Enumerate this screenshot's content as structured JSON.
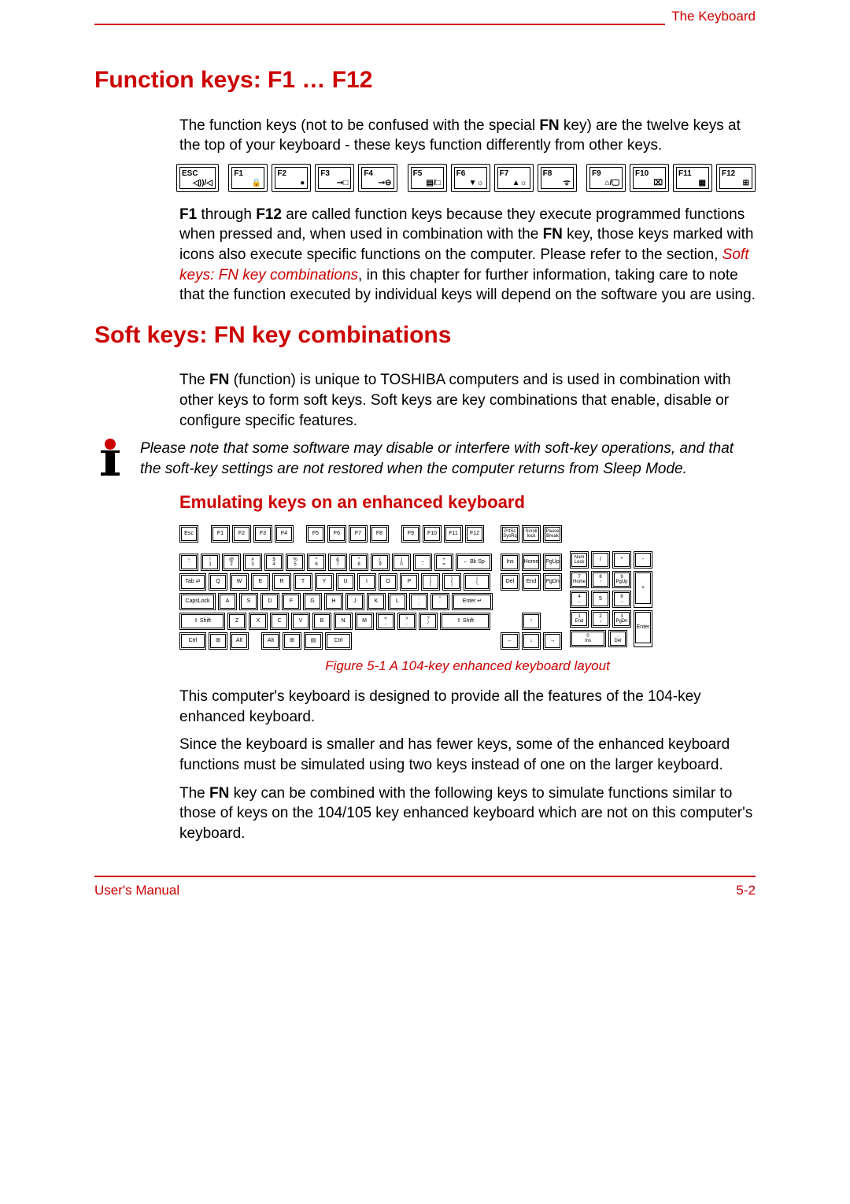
{
  "header": {
    "section": "The Keyboard"
  },
  "h1_a": "Function keys: F1 … F12",
  "p1_a": "The function keys (not to be confused with the special ",
  "p1_bold": "FN",
  "p1_b": " key) are the twelve keys at the top of your keyboard - these keys function differently from other keys.",
  "fkeys": {
    "esc": "ESC",
    "esc_sym": "◁))/◁",
    "labels": [
      "F1",
      "F2",
      "F3",
      "F4",
      "F5",
      "F6",
      "F7",
      "F8",
      "F9",
      "F10",
      "F11",
      "F12"
    ],
    "syms": [
      "🔒",
      "●",
      "⊸□",
      "⊸⊖",
      "▤/□",
      "▼☼",
      "▲☼",
      "ᯤ",
      "⌂/🖵",
      "⌧",
      "▦",
      "⊞"
    ]
  },
  "p2_a": "F1",
  "p2_b": " through ",
  "p2_c": "F12",
  "p2_d": " are called function keys because they execute programmed functions when pressed and, when used in combination with the ",
  "p2_e": "FN",
  "p2_f": " key, those keys marked with icons also execute specific functions on the computer. Please refer to the section, ",
  "p2_link": "Soft keys: FN key combinations",
  "p2_g": ", in this chapter for further information, taking care to note that the function executed by individual keys will depend on the software you are using.",
  "h1_b": "Soft keys: FN key combinations",
  "p3_a": "The ",
  "p3_b": "FN",
  "p3_c": " (function) is unique to TOSHIBA computers and is used in combination with other keys to form soft keys. Soft keys are key combinations that enable, disable or configure specific features.",
  "note": "Please note that some software may disable or interfere with soft-key operations, and that the soft-key settings are not restored when the computer returns from Sleep Mode.",
  "h2_a": "Emulating keys on an enhanced keyboard",
  "caption": "Figure 5-1 A 104-key enhanced keyboard layout",
  "p4": "This computer's keyboard is designed to provide all the features of the 104-key enhanced keyboard.",
  "p5": "Since the keyboard is smaller and has fewer keys, some of the enhanced keyboard functions must be simulated using two keys instead of one on the larger keyboard.",
  "p6_a": "The ",
  "p6_b": "FN",
  "p6_c": " key can be combined with the following keys to simulate functions similar to those of keys on the 104/105 key enhanced keyboard which are not on this computer's keyboard.",
  "footer": {
    "left": "User's Manual",
    "right": "5-2"
  },
  "kb104": {
    "row0_main": [
      "Esc",
      "",
      "F1",
      "F2",
      "F3",
      "F4",
      "",
      "F5",
      "F6",
      "F7",
      "F8",
      "",
      "F9",
      "F10",
      "F11",
      "F12"
    ],
    "row0_nav": [
      "PrtSc\nSysRq",
      "Scroll\nlock",
      "Pause\nBreak"
    ],
    "row1_main": [
      "~\n`",
      "!\n1",
      "@\n2",
      "#\n3",
      "$\n4",
      "%\n5",
      "^\n6",
      "&\n7",
      "*\n8",
      "(\n9",
      ")\n0",
      "_\n-",
      "+\n=",
      "← Bk Sp"
    ],
    "row1_nav": [
      "Ins",
      "Home",
      "PgUp"
    ],
    "row1_num": [
      "Num\nLock",
      "/",
      "*",
      "-"
    ],
    "row2_main": [
      "Tab ⇄",
      "Q",
      "W",
      "E",
      "R",
      "T",
      "Y",
      "U",
      "I",
      "O",
      "P",
      "{\n[",
      "}\n]",
      "|\n\\"
    ],
    "row2_nav": [
      "Del",
      "End",
      "PgDn"
    ],
    "row2_num": [
      "7\nHome",
      "8\n↑",
      "9\nPgUp"
    ],
    "row3_main": [
      "CapsLock",
      "A",
      "S",
      "D",
      "F",
      "G",
      "H",
      "J",
      "K",
      "L",
      ":\n;",
      "\"\n'",
      "Enter  ↵"
    ],
    "row3_num": [
      "4\n←",
      "5",
      "6\n→"
    ],
    "row4_main": [
      "⇧ Shift",
      "Z",
      "X",
      "C",
      "V",
      "B",
      "N",
      "M",
      "<\n,",
      ">\n.",
      "?\n/",
      "⇧ Shift"
    ],
    "row4_nav": [
      "↑"
    ],
    "row4_num": [
      "1\nEnd",
      "2\n↓",
      "3\nPgDn"
    ],
    "row5_main": [
      "Ctrl",
      "⊞",
      "Alt",
      "",
      "Alt",
      "⊞",
      "▤",
      "Ctrl"
    ],
    "row5_nav": [
      "←",
      "↓",
      "→"
    ],
    "row5_num": [
      "0\nIns",
      ".\nDel"
    ],
    "num_plus": "+",
    "num_enter": "Enter"
  }
}
